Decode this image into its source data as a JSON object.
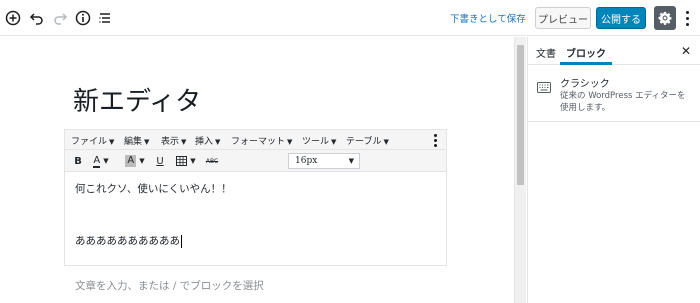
{
  "header": {
    "save_draft": "下書きとして保存",
    "preview": "プレビュー",
    "publish": "公開する",
    "icons": [
      "add-block-icon",
      "undo-icon",
      "redo-icon",
      "info-icon",
      "list-view-icon",
      "gear-icon",
      "more-options-icon"
    ],
    "accent_color": "#0085ba"
  },
  "editor": {
    "title": "新エディタ",
    "menubar": [
      "ファイル",
      "編集",
      "表示",
      "挿入",
      "フォーマット",
      "ツール",
      "テーブル"
    ],
    "font_size": "16px",
    "paragraphs": [
      "何これクソ、使いにくいやん！！",
      "ああああああああああ"
    ],
    "placeholder": "文章を入力、または / でブロックを選択"
  },
  "sidebar": {
    "tabs": [
      "文書",
      "ブロック"
    ],
    "active_tab": "ブロック",
    "block": {
      "name": "クラシック",
      "description": "従来の WordPress エディターを使用します。"
    }
  }
}
